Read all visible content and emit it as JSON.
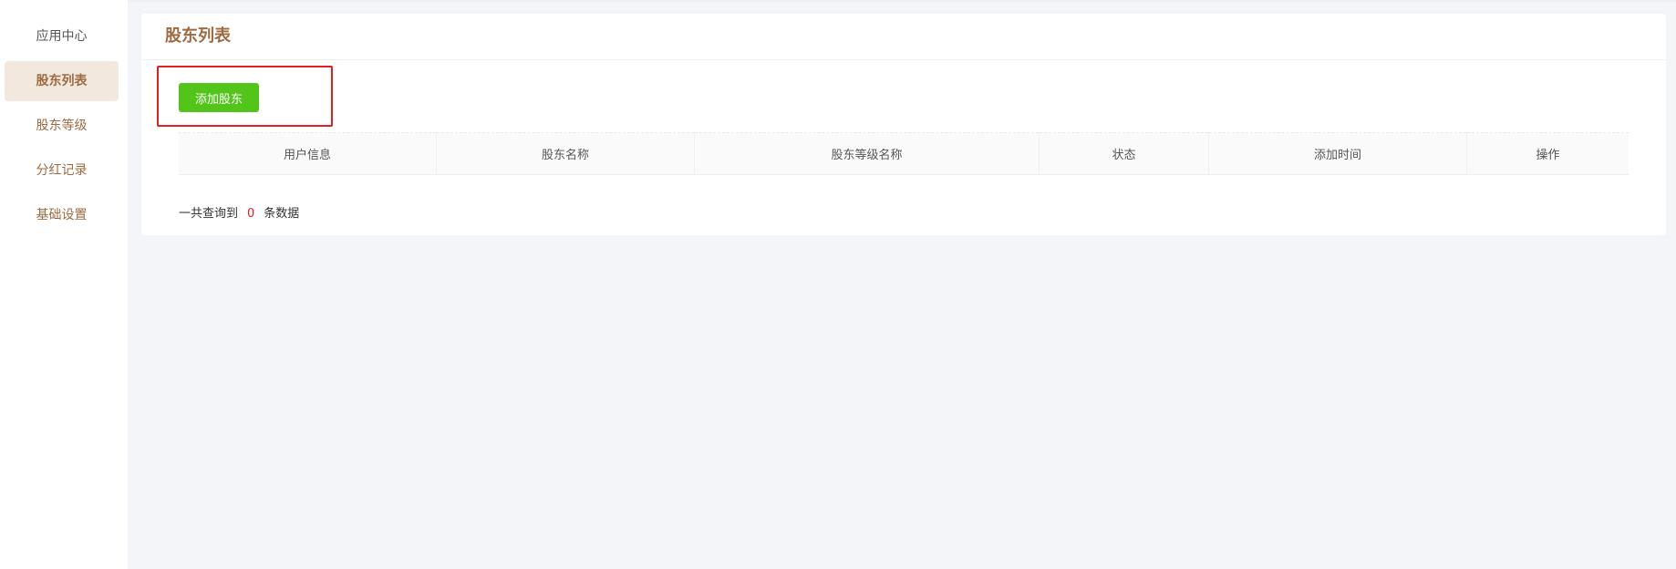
{
  "sidebar": {
    "items": [
      {
        "label": "应用中心"
      },
      {
        "label": "股东列表"
      },
      {
        "label": "股东等级"
      },
      {
        "label": "分红记录"
      },
      {
        "label": "基础设置"
      }
    ]
  },
  "page": {
    "title": "股东列表"
  },
  "toolbar": {
    "add_label": "添加股东"
  },
  "table": {
    "columns": [
      "用户信息",
      "股东名称",
      "股东等级名称",
      "状态",
      "添加时间",
      "操作"
    ]
  },
  "summary": {
    "prefix": "一共查询到",
    "count": "0",
    "suffix": "条数据"
  },
  "colors": {
    "accent": "#9c6b42",
    "active_bg": "#f3e8dd",
    "button_green": "#52c41a",
    "highlight_red": "#e02020"
  }
}
